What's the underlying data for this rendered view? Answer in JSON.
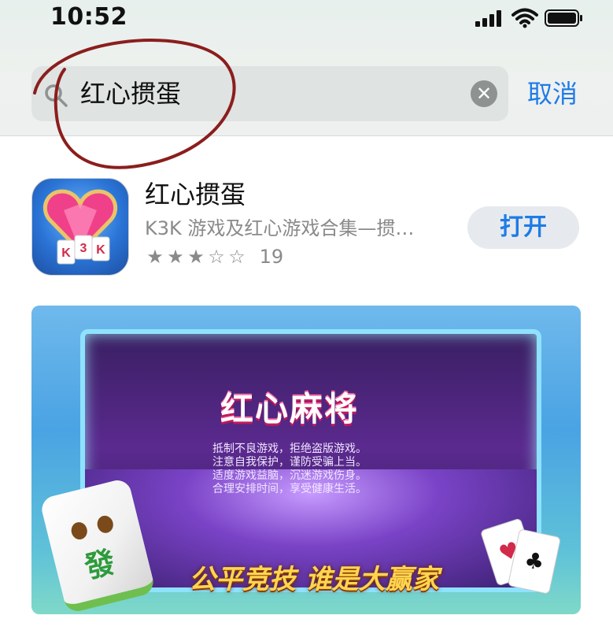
{
  "status": {
    "time": "10:52"
  },
  "search": {
    "query": "红心掼蛋",
    "cancel_label": "取消"
  },
  "result": {
    "app_name": "红心掼蛋",
    "subtitle": "K3K 游戏及红心游戏合集—掼…",
    "rating_value": 3,
    "rating_count": "19",
    "open_label": "打开",
    "icon_text": "K3K"
  },
  "screenshot": {
    "title": "红心麻将",
    "notice_lines": [
      "抵制不良游戏，拒绝盗版游戏。",
      "注意自我保护，谨防受骗上当。",
      "适度游戏益脑，沉迷游戏伤身。",
      "合理安排时间，享受健康生活。"
    ],
    "slogan": "公平竞技 谁是大赢家",
    "tile_char": "發"
  },
  "colors": {
    "accent": "#1f7be7",
    "annotation": "#8b1e1e"
  }
}
